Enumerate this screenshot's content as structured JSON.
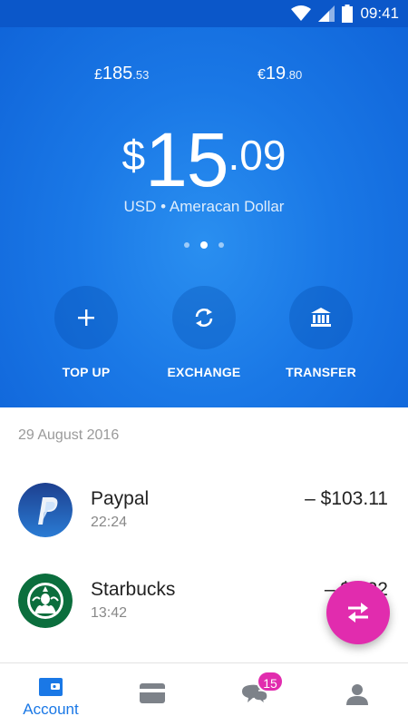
{
  "status_bar": {
    "time": "09:41"
  },
  "balances": {
    "gbp": {
      "symbol": "£",
      "integer": "185",
      "decimal": ".53"
    },
    "eur": {
      "symbol": "€",
      "integer": "19",
      "decimal": ".80"
    }
  },
  "main_balance": {
    "symbol": "$",
    "integer": "15",
    "decimal": ".09"
  },
  "currency_line": "USD • Ameracan Dollar",
  "pager": {
    "count": 3,
    "active_index": 1
  },
  "actions": {
    "top_up": "TOP UP",
    "exchange": "EXCHANGE",
    "transfer": "TRANSFER"
  },
  "transactions": {
    "date": "29 August 2016",
    "items": [
      {
        "name": "Paypal",
        "time": "22:24",
        "amount": "– $103.11"
      },
      {
        "name": "Starbucks",
        "time": "13:42",
        "amount": "– $5.22"
      }
    ]
  },
  "bottom_nav": {
    "account_label": "Account",
    "chat_badge": "15"
  },
  "colors": {
    "brand_blue": "#1a78e6",
    "accent_pink": "#e12cae"
  }
}
